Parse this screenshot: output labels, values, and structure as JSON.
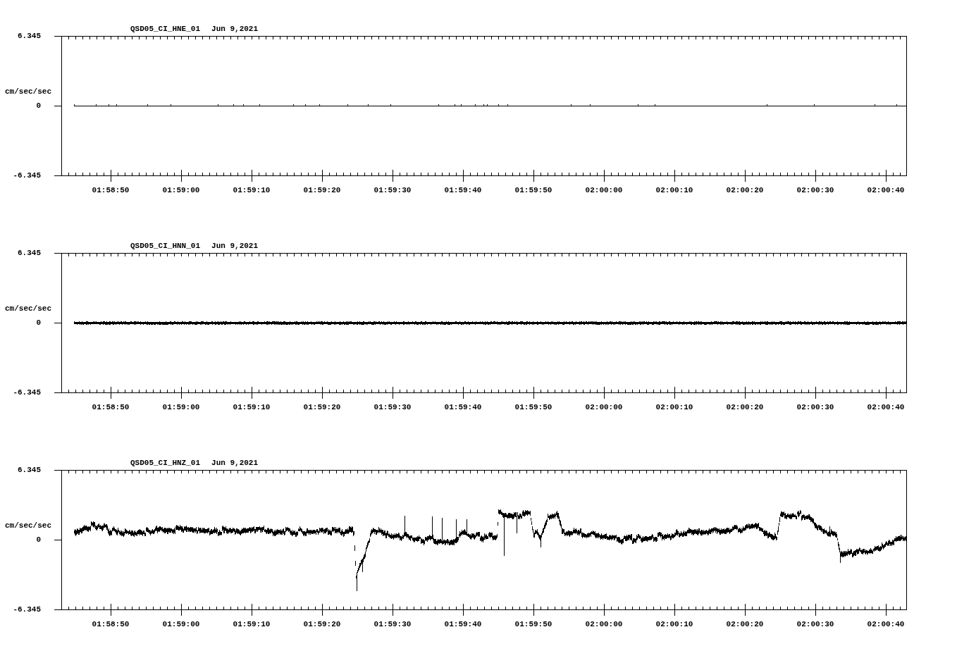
{
  "panels": [
    {
      "station": "QSD05_CI_HNE_01",
      "date": "Jun 9,2021",
      "y_max": "6.345",
      "y_unit": "cm/sec/sec",
      "y_zero": "0",
      "y_min": "-6.345",
      "kind": "flat",
      "time_labels": [
        "01:58:50",
        "01:59:00",
        "01:59:10",
        "01:59:20",
        "01:59:30",
        "01:59:40",
        "01:59:50",
        "02:00:00",
        "02:00:10",
        "02:00:20",
        "02:00:30",
        "02:00:40"
      ]
    },
    {
      "station": "QSD05_CI_HNN_01",
      "date": "Jun 9,2021",
      "y_max": "6.345",
      "y_unit": "cm/sec/sec",
      "y_zero": "0",
      "y_min": "-6.345",
      "kind": "noisy",
      "time_labels": [
        "01:58:50",
        "01:59:00",
        "01:59:10",
        "01:59:20",
        "01:59:30",
        "01:59:40",
        "01:59:50",
        "02:00:00",
        "02:00:10",
        "02:00:20",
        "02:00:30",
        "02:00:40"
      ]
    },
    {
      "station": "QSD05_CI_HNZ_01",
      "date": "Jun 9,2021",
      "y_max": "6.345",
      "y_unit": "cm/sec/sec",
      "y_zero": "0",
      "y_min": "-6.345",
      "kind": "event",
      "time_labels": [
        "01:58:50",
        "01:59:00",
        "01:59:10",
        "01:59:20",
        "01:59:30",
        "01:59:40",
        "01:59:50",
        "02:00:00",
        "02:00:10",
        "02:00:20",
        "02:00:30",
        "02:00:40"
      ]
    }
  ]
}
